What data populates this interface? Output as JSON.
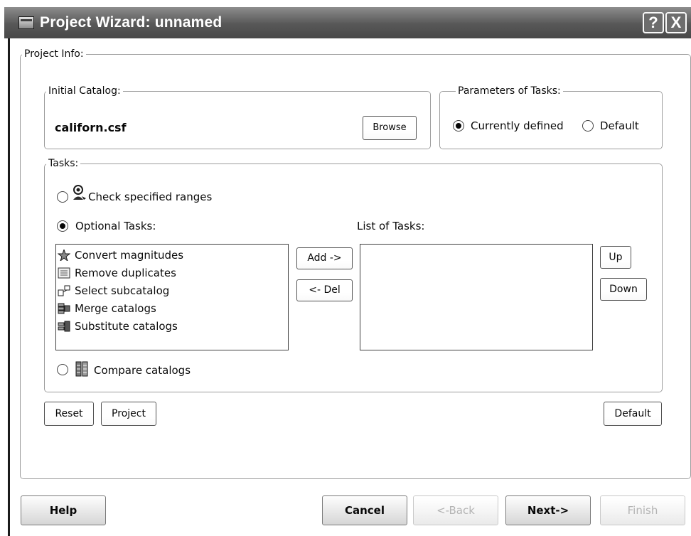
{
  "window": {
    "title": "Project Wizard: unnamed",
    "help_glyph": "?",
    "close_glyph": "X"
  },
  "project_info": {
    "legend": "Project Info:"
  },
  "initial_catalog": {
    "legend": "Initial Catalog:",
    "filename": "californ.csf",
    "browse_label": "Browse"
  },
  "parameters": {
    "legend": "Parameters of Tasks:",
    "options": [
      {
        "label": "Currently defined",
        "selected": true
      },
      {
        "label": "Default",
        "selected": false
      }
    ]
  },
  "tasks": {
    "legend": "Tasks:",
    "check_ranges_label": "Check specified ranges",
    "check_ranges_selected": false,
    "optional_tasks_label": "Optional Tasks:",
    "optional_tasks_selected": true,
    "available": [
      {
        "label": "Convert magnitudes",
        "icon": "star-gear-icon"
      },
      {
        "label": "Remove duplicates",
        "icon": "duplicate-list-icon"
      },
      {
        "label": "Select subcatalog",
        "icon": "select-tree-icon"
      },
      {
        "label": "Merge catalogs",
        "icon": "merge-stack-icon"
      },
      {
        "label": "Substitute catalogs",
        "icon": "substitute-stack-icon"
      }
    ],
    "add_label": "Add ->",
    "del_label": "<- Del",
    "list_label": "List of Tasks:",
    "list_items": [],
    "up_label": "Up",
    "down_label": "Down",
    "compare_label": "Compare catalogs",
    "compare_selected": false
  },
  "bottom_row": {
    "reset_label": "Reset",
    "project_label": "Project",
    "default_label": "Default"
  },
  "footer": {
    "help_label": "Help",
    "cancel_label": "Cancel",
    "back_label": "<-Back",
    "next_label": "Next->",
    "finish_label": "Finish",
    "back_enabled": false,
    "finish_enabled": false
  }
}
